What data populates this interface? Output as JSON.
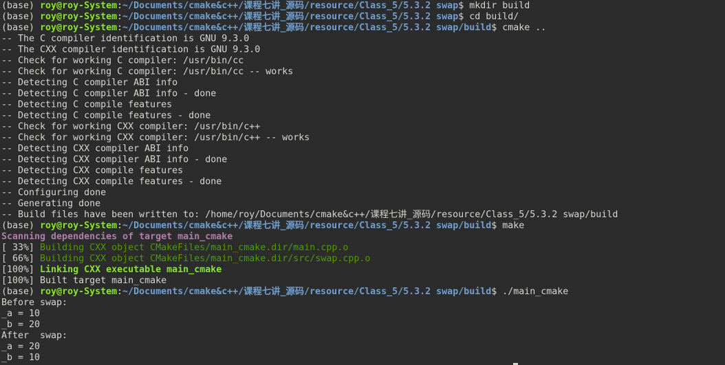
{
  "colors": {
    "background": "#2c2c2c",
    "text": "#d3d7cf",
    "user_host": "#8ae234",
    "path": "#729fcf",
    "scan_magenta": "#ad7fa8",
    "build_green": "#4e9a06"
  },
  "lines": [
    {
      "segments": [
        {
          "t": "(base) ",
          "k": "plain"
        },
        {
          "t": "roy@roy-System",
          "k": "user"
        },
        {
          "t": ":",
          "k": "plain"
        },
        {
          "t": "~/Documents/cmake&c++/课程七讲_源码/resource/Class_5/5.3.2 swap",
          "k": "path"
        },
        {
          "t": "$ mkdir build",
          "k": "plain"
        }
      ]
    },
    {
      "segments": [
        {
          "t": "(base) ",
          "k": "plain"
        },
        {
          "t": "roy@roy-System",
          "k": "user"
        },
        {
          "t": ":",
          "k": "plain"
        },
        {
          "t": "~/Documents/cmake&c++/课程七讲_源码/resource/Class_5/5.3.2 swap",
          "k": "path"
        },
        {
          "t": "$ cd build/",
          "k": "plain"
        }
      ]
    },
    {
      "segments": [
        {
          "t": "(base) ",
          "k": "plain"
        },
        {
          "t": "roy@roy-System",
          "k": "user"
        },
        {
          "t": ":",
          "k": "plain"
        },
        {
          "t": "~/Documents/cmake&c++/课程七讲_源码/resource/Class_5/5.3.2 swap/build",
          "k": "path"
        },
        {
          "t": "$ cmake ..",
          "k": "plain"
        }
      ]
    },
    {
      "segments": [
        {
          "t": "-- The C compiler identification is GNU 9.3.0",
          "k": "plain"
        }
      ]
    },
    {
      "segments": [
        {
          "t": "-- The CXX compiler identification is GNU 9.3.0",
          "k": "plain"
        }
      ]
    },
    {
      "segments": [
        {
          "t": "-- Check for working C compiler: /usr/bin/cc",
          "k": "plain"
        }
      ]
    },
    {
      "segments": [
        {
          "t": "-- Check for working C compiler: /usr/bin/cc -- works",
          "k": "plain"
        }
      ]
    },
    {
      "segments": [
        {
          "t": "-- Detecting C compiler ABI info",
          "k": "plain"
        }
      ]
    },
    {
      "segments": [
        {
          "t": "-- Detecting C compiler ABI info - done",
          "k": "plain"
        }
      ]
    },
    {
      "segments": [
        {
          "t": "-- Detecting C compile features",
          "k": "plain"
        }
      ]
    },
    {
      "segments": [
        {
          "t": "-- Detecting C compile features - done",
          "k": "plain"
        }
      ]
    },
    {
      "segments": [
        {
          "t": "-- Check for working CXX compiler: /usr/bin/c++",
          "k": "plain"
        }
      ]
    },
    {
      "segments": [
        {
          "t": "-- Check for working CXX compiler: /usr/bin/c++ -- works",
          "k": "plain"
        }
      ]
    },
    {
      "segments": [
        {
          "t": "-- Detecting CXX compiler ABI info",
          "k": "plain"
        }
      ]
    },
    {
      "segments": [
        {
          "t": "-- Detecting CXX compiler ABI info - done",
          "k": "plain"
        }
      ]
    },
    {
      "segments": [
        {
          "t": "-- Detecting CXX compile features",
          "k": "plain"
        }
      ]
    },
    {
      "segments": [
        {
          "t": "-- Detecting CXX compile features - done",
          "k": "plain"
        }
      ]
    },
    {
      "segments": [
        {
          "t": "-- Configuring done",
          "k": "plain"
        }
      ]
    },
    {
      "segments": [
        {
          "t": "-- Generating done",
          "k": "plain"
        }
      ]
    },
    {
      "segments": [
        {
          "t": "-- Build files have been written to: /home/roy/Documents/cmake&c++/课程七讲_源码/resource/Class_5/5.3.2 swap/build",
          "k": "plain"
        }
      ]
    },
    {
      "segments": [
        {
          "t": "(base) ",
          "k": "plain"
        },
        {
          "t": "roy@roy-System",
          "k": "user"
        },
        {
          "t": ":",
          "k": "plain"
        },
        {
          "t": "~/Documents/cmake&c++/课程七讲_源码/resource/Class_5/5.3.2 swap/build",
          "k": "path"
        },
        {
          "t": "$ make",
          "k": "plain"
        }
      ]
    },
    {
      "segments": [
        {
          "t": "Scanning dependencies of target main_cmake",
          "k": "magenta"
        }
      ]
    },
    {
      "segments": [
        {
          "t": "[ 33%] ",
          "k": "plain"
        },
        {
          "t": "Building CXX object CMakeFiles/main_cmake.dir/main.cpp.o",
          "k": "green"
        }
      ]
    },
    {
      "segments": [
        {
          "t": "[ 66%] ",
          "k": "plain"
        },
        {
          "t": "Building CXX object CMakeFiles/main_cmake.dir/src/swap.cpp.o",
          "k": "green"
        }
      ]
    },
    {
      "segments": [
        {
          "t": "[100%] ",
          "k": "plain"
        },
        {
          "t": "Linking CXX executable main_cmake",
          "k": "greenbold"
        }
      ]
    },
    {
      "segments": [
        {
          "t": "[100%] Built target main_cmake",
          "k": "plain"
        }
      ]
    },
    {
      "segments": [
        {
          "t": "(base) ",
          "k": "plain"
        },
        {
          "t": "roy@roy-System",
          "k": "user"
        },
        {
          "t": ":",
          "k": "plain"
        },
        {
          "t": "~/Documents/cmake&c++/课程七讲_源码/resource/Class_5/5.3.2 swap/build",
          "k": "path"
        },
        {
          "t": "$ ./main_cmake",
          "k": "plain"
        }
      ]
    },
    {
      "segments": [
        {
          "t": "Before swap:",
          "k": "plain"
        }
      ]
    },
    {
      "segments": [
        {
          "t": "_a = 10",
          "k": "plain"
        }
      ]
    },
    {
      "segments": [
        {
          "t": "_b = 20",
          "k": "plain"
        }
      ]
    },
    {
      "segments": [
        {
          "t": "After  swap:",
          "k": "plain"
        }
      ]
    },
    {
      "segments": [
        {
          "t": "_a = 20",
          "k": "plain"
        }
      ]
    },
    {
      "segments": [
        {
          "t": "_b = 10",
          "k": "plain"
        }
      ]
    }
  ]
}
